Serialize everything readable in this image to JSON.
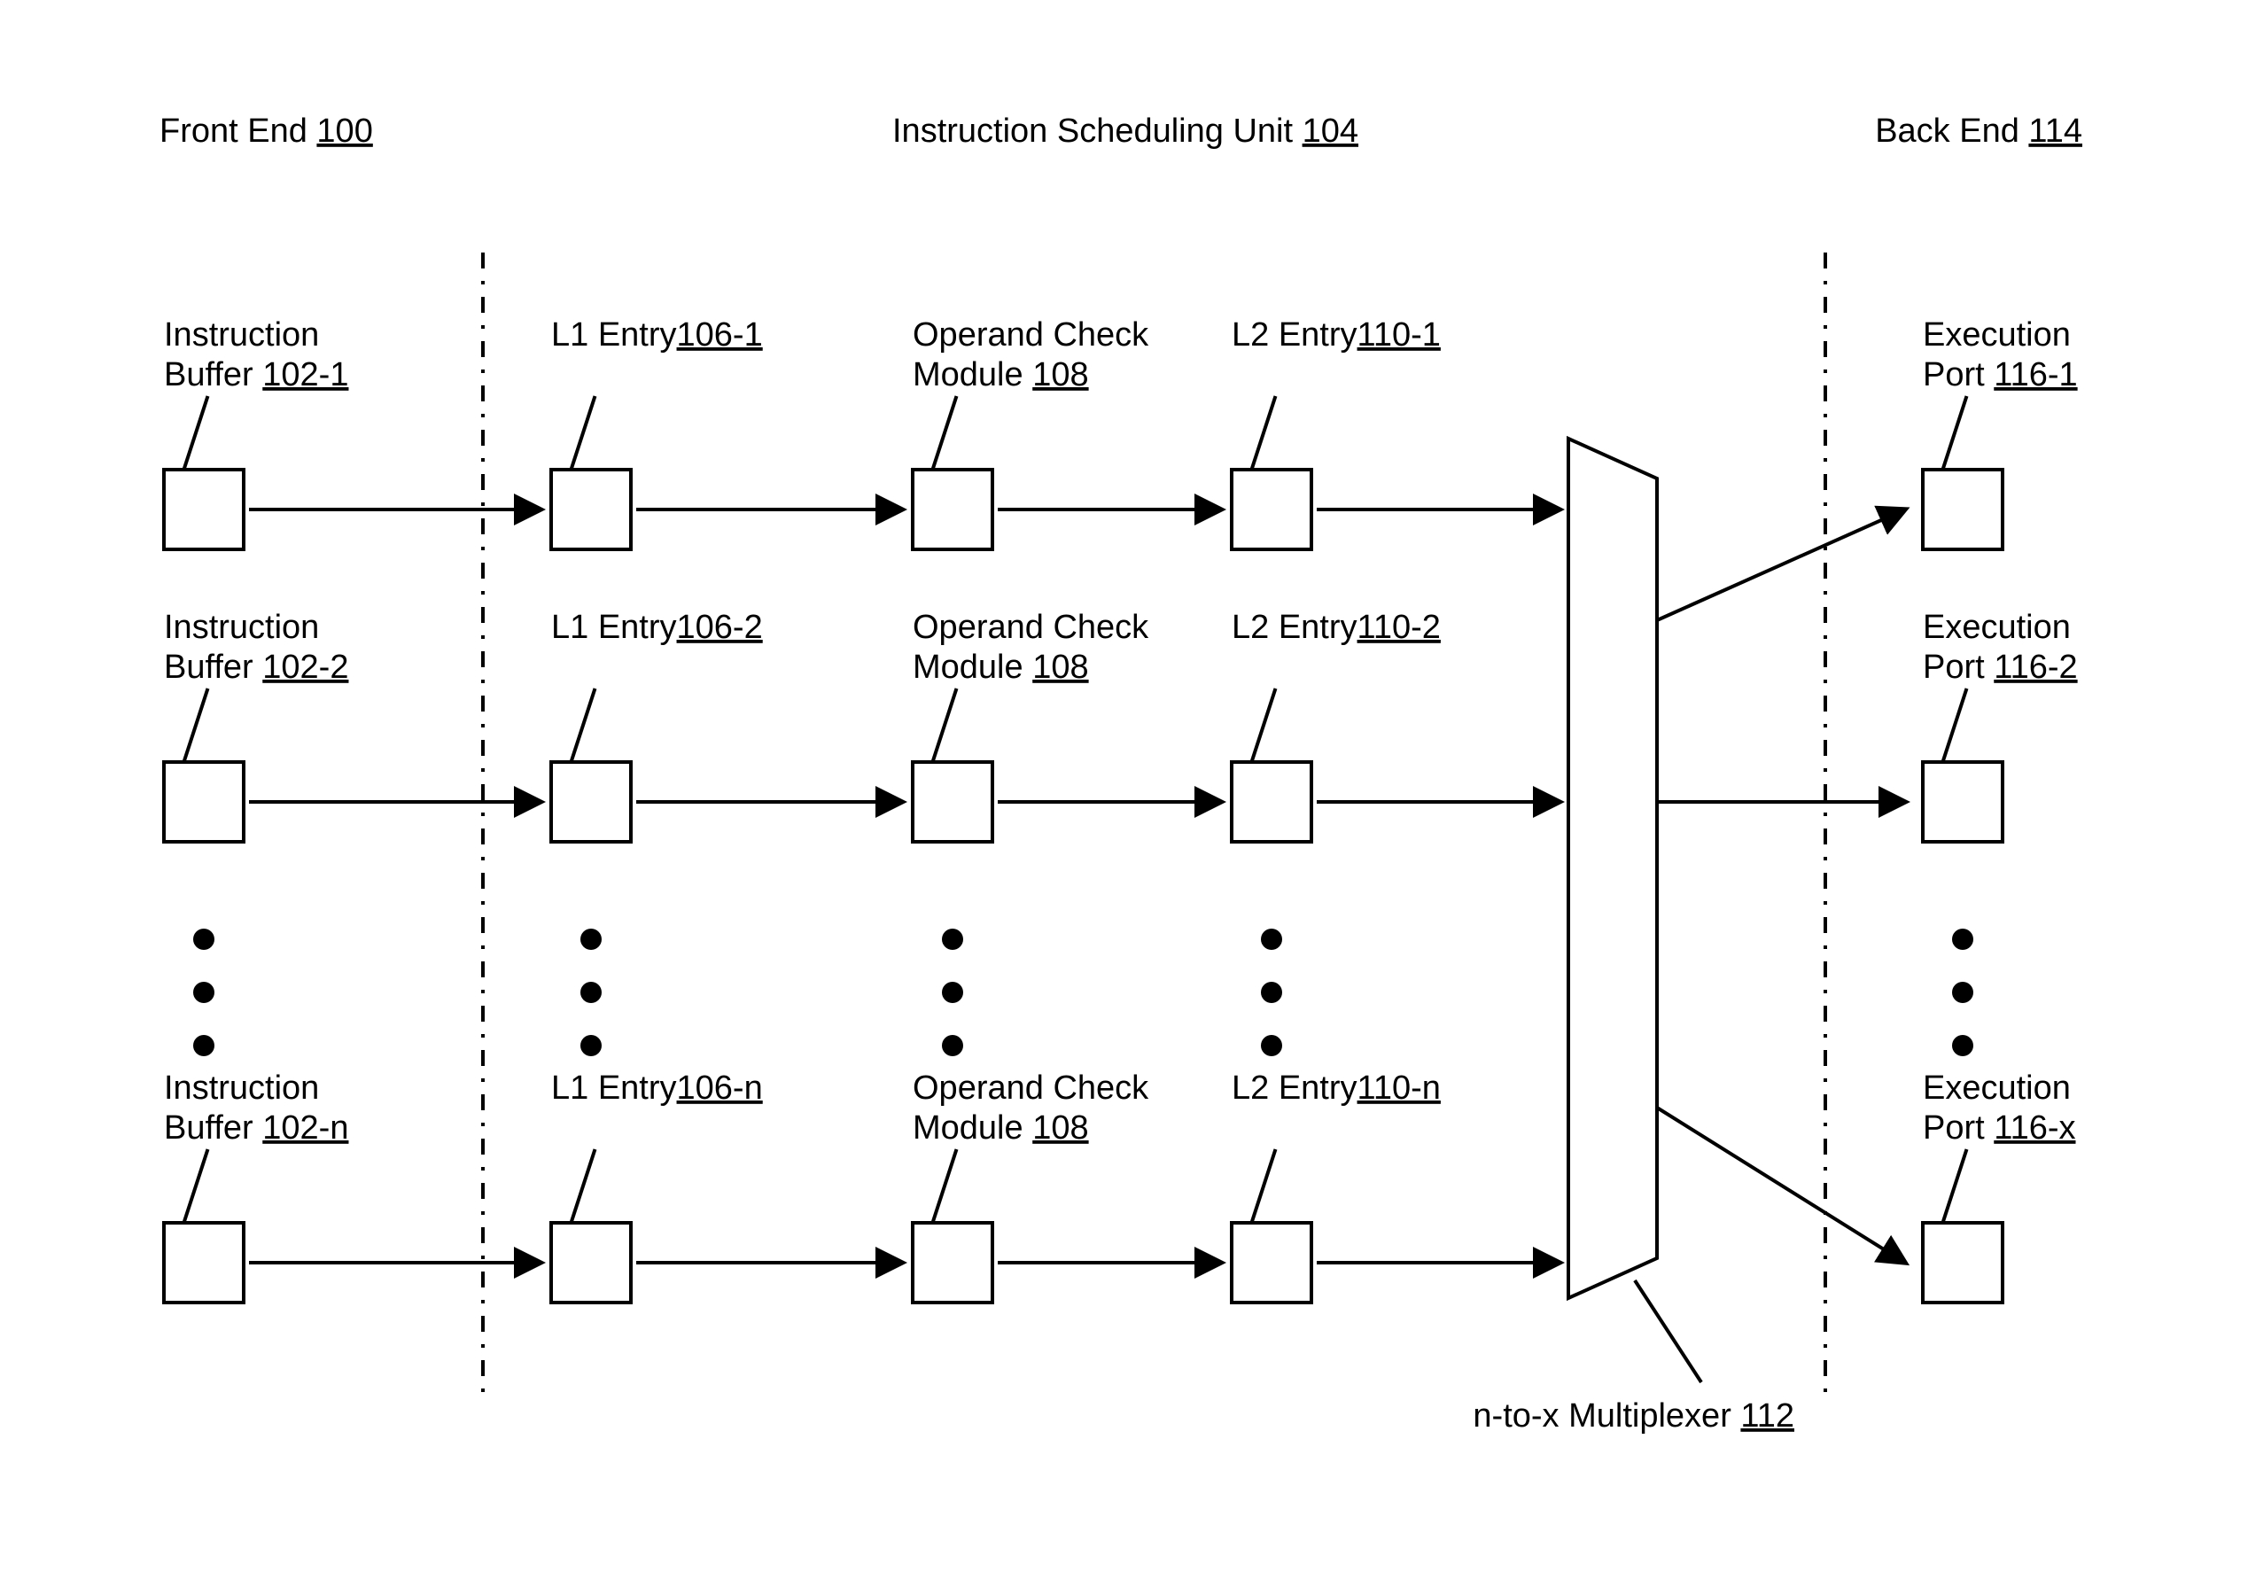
{
  "sections": {
    "frontEnd": {
      "title": "Front End ",
      "ref": "100"
    },
    "scheduler": {
      "title": "Instruction Scheduling Unit ",
      "ref": "104"
    },
    "backEnd": {
      "title": "Back End ",
      "ref": "114"
    }
  },
  "rows": [
    {
      "ib": {
        "l1": "Instruction",
        "l2_pre": "Buffer ",
        "l2_ref": "102-1"
      },
      "l1e": {
        "l1": "L1 Entry",
        "l2_pre": "",
        "l2_ref": "106-1"
      },
      "oc": {
        "l1": "Operand Check",
        "l2_pre": "Module ",
        "l2_ref": "108"
      },
      "l2e": {
        "l1": "L2 Entry",
        "l2_pre": "",
        "l2_ref": "110-1"
      },
      "ep": {
        "l1": "Execution",
        "l2_pre": "Port ",
        "l2_ref": "116-1"
      }
    },
    {
      "ib": {
        "l1": "Instruction",
        "l2_pre": "Buffer ",
        "l2_ref": "102-2"
      },
      "l1e": {
        "l1": "L1 Entry",
        "l2_pre": "",
        "l2_ref": "106-2"
      },
      "oc": {
        "l1": "Operand Check",
        "l2_pre": "Module ",
        "l2_ref": "108"
      },
      "l2e": {
        "l1": "L2 Entry",
        "l2_pre": "",
        "l2_ref": "110-2"
      },
      "ep": {
        "l1": "Execution",
        "l2_pre": "Port ",
        "l2_ref": "116-2"
      }
    },
    {
      "ib": {
        "l1": "Instruction",
        "l2_pre": "Buffer ",
        "l2_ref": "102-n"
      },
      "l1e": {
        "l1": "L1 Entry",
        "l2_pre": "",
        "l2_ref": "106-n"
      },
      "oc": {
        "l1": "Operand Check",
        "l2_pre": "Module ",
        "l2_ref": "108"
      },
      "l2e": {
        "l1": "L2 Entry",
        "l2_pre": "",
        "l2_ref": "110-n"
      },
      "ep": {
        "l1": "Execution",
        "l2_pre": "Port ",
        "l2_ref": "116-x"
      }
    }
  ],
  "mux": {
    "pre": "n-to-x Multiplexer ",
    "ref": "112"
  }
}
